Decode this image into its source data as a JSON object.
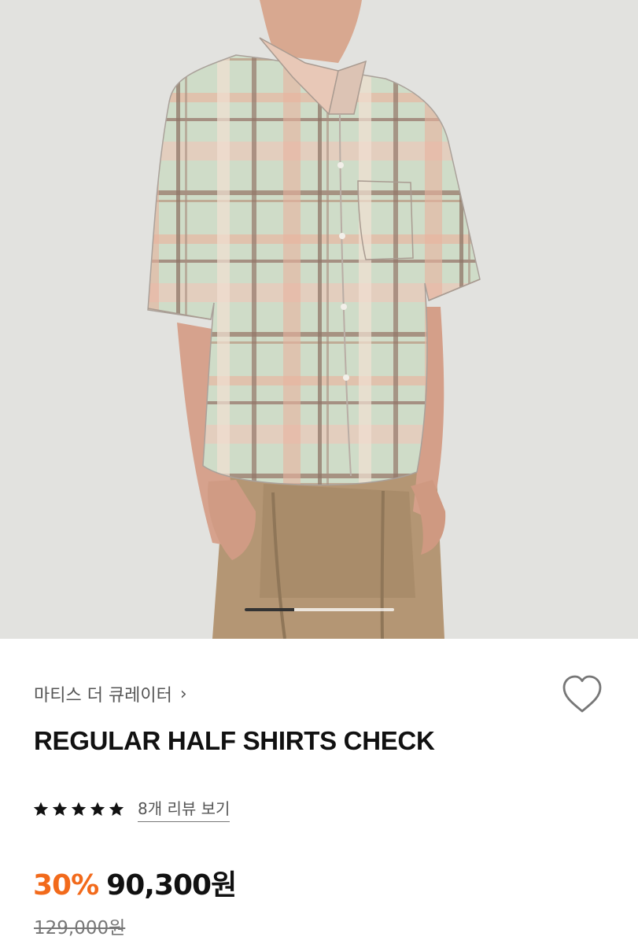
{
  "product": {
    "image_alt": "REGULAR HALF SHIRTS CHECK",
    "carousel_progress": 0.33,
    "brand_label": "마티스 더 큐레이터",
    "title": "REGULAR HALF SHIRTS CHECK",
    "rating_stars": 5,
    "review_link_label": "8개 리뷰 보기",
    "discount_label": "30%",
    "price_label": "90,300원",
    "original_price_label": "129,000원"
  },
  "icons": {
    "brand_chevron": "chevron-right-icon",
    "wishlist": "heart-icon",
    "star": "star-icon"
  },
  "colors": {
    "accent": "#f26a1b",
    "text": "#111111",
    "muted": "#777777"
  }
}
